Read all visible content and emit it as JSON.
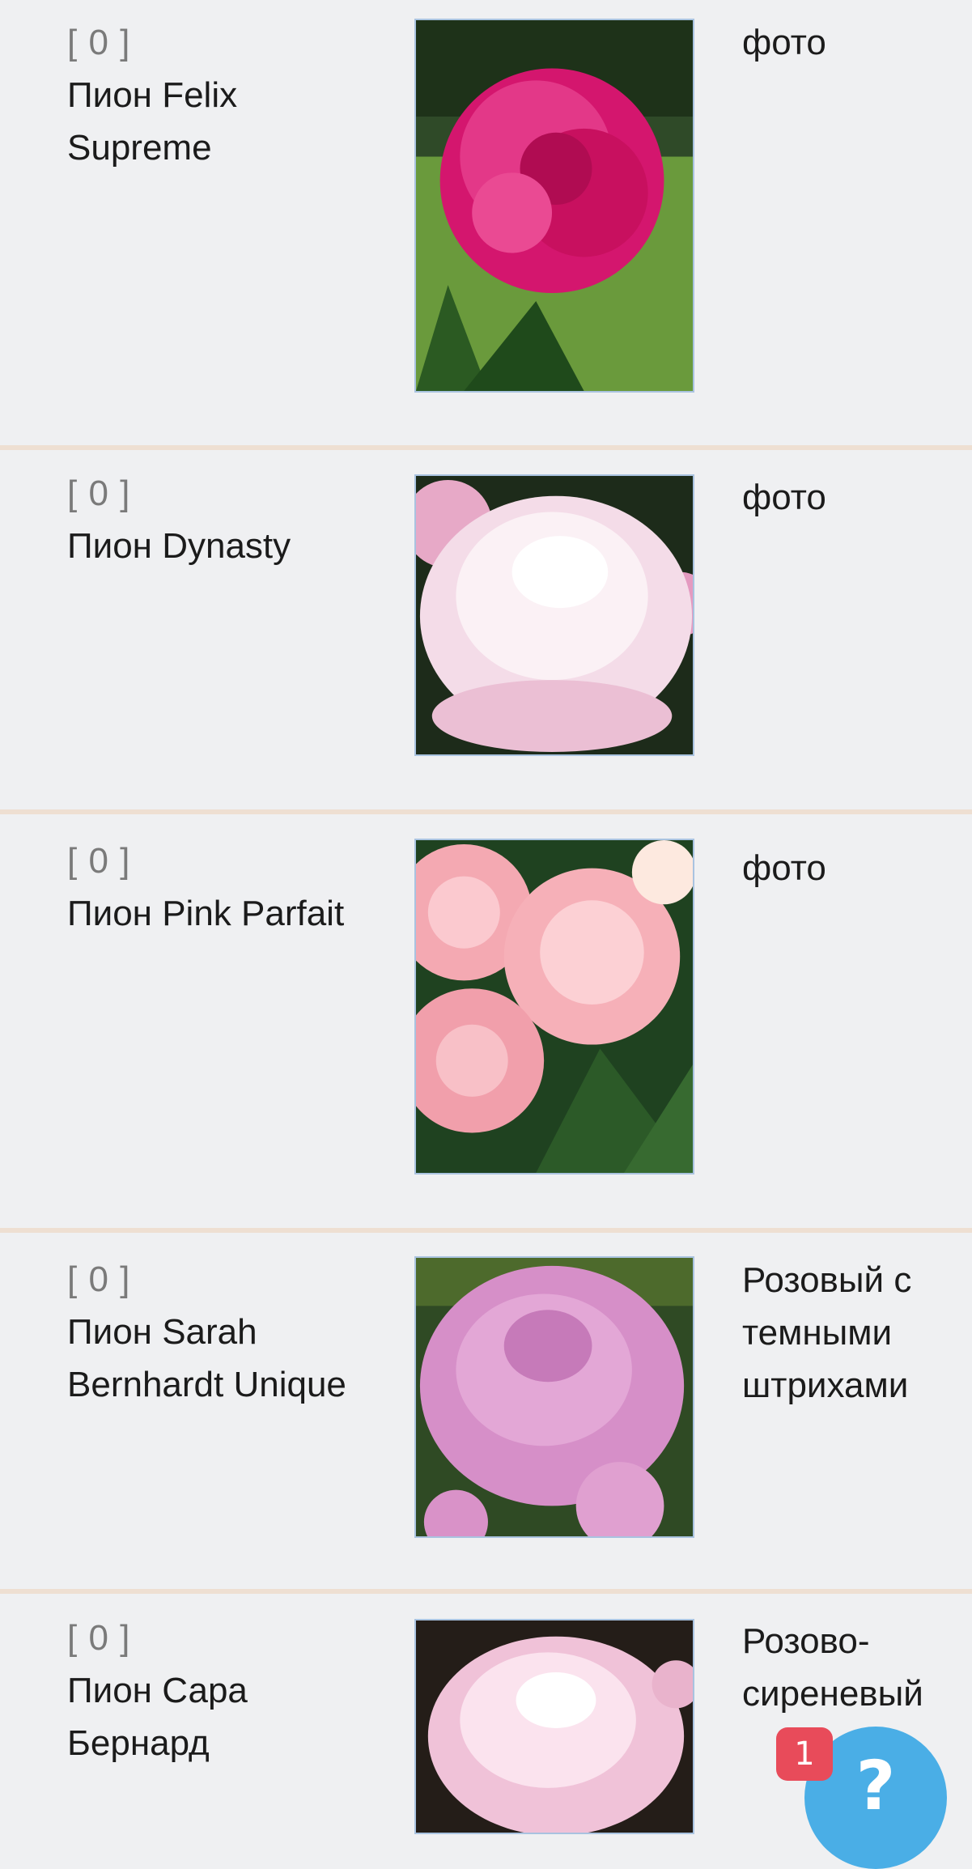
{
  "products": [
    {
      "count": "[ 0 ]",
      "name": "Пион Felix Supreme",
      "description": "фото"
    },
    {
      "count": "[ 0 ]",
      "name": "Пион Dynasty",
      "description": "фото"
    },
    {
      "count": "[ 0 ]",
      "name": "Пион Pink Parfait",
      "description": "фото"
    },
    {
      "count": "[ 0 ]",
      "name": "Пион Sarah Bernhardt Unique",
      "description": "Розовый с темными штрихами"
    },
    {
      "count": "[ 0 ]",
      "name": "Пион Сара Бернард",
      "description": "Розово-сиреневый"
    }
  ],
  "help_widget": {
    "icon": "question-mark-icon",
    "glyph": "?",
    "badge": "1",
    "color": "#4aaee6",
    "badge_color": "#e84b5a"
  }
}
